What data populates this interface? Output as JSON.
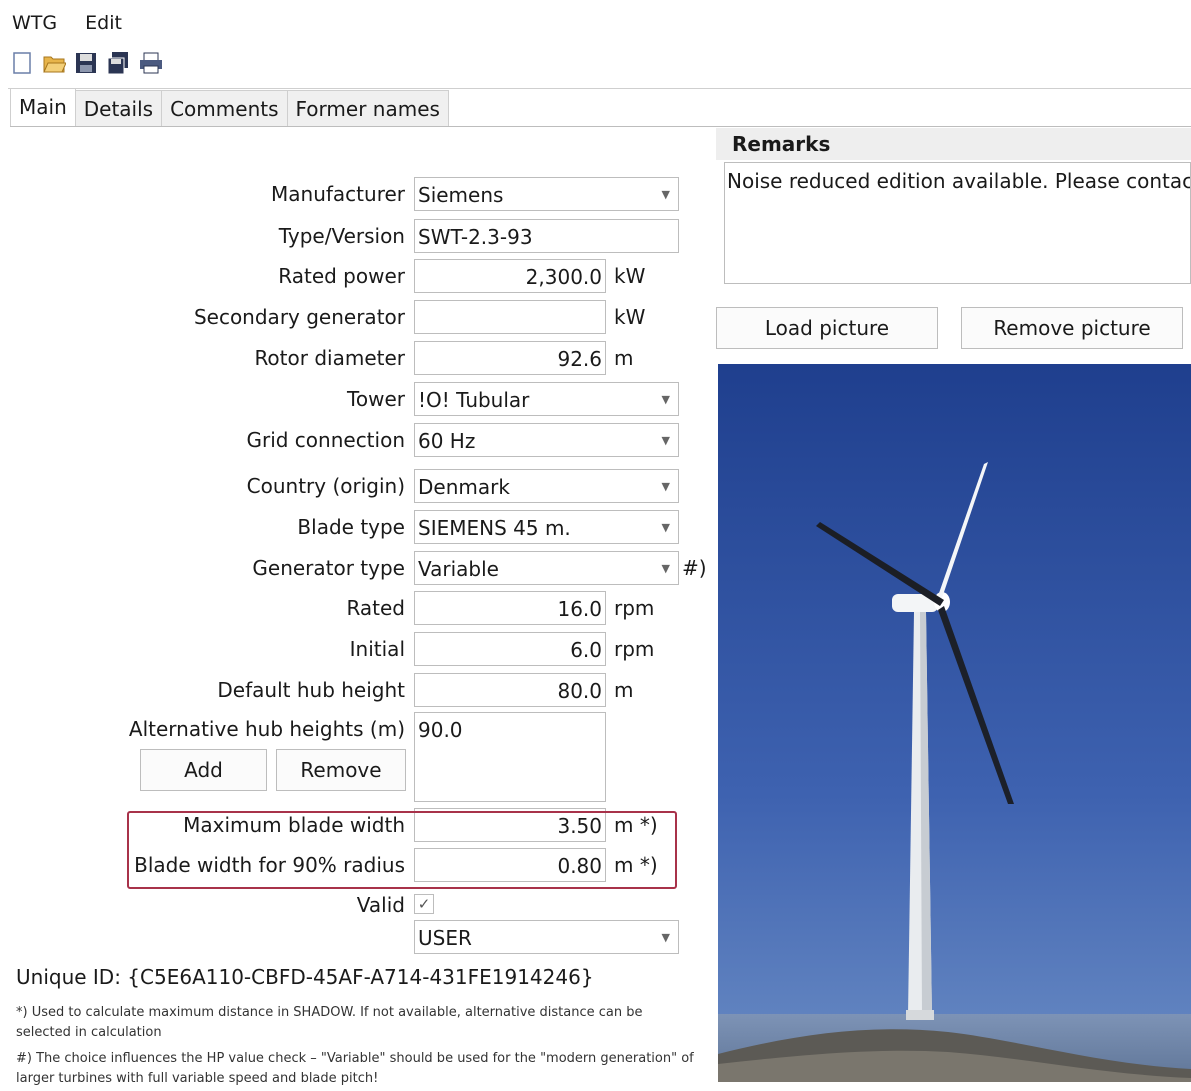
{
  "menu": {
    "items": [
      "WTG",
      "Edit"
    ]
  },
  "toolbar": {
    "icons": [
      "new-icon",
      "open-folder-icon",
      "save-icon",
      "save-as-icon",
      "print-icon"
    ]
  },
  "tabs": [
    "Main",
    "Details",
    "Comments",
    "Former names"
  ],
  "form": {
    "manufacturer": {
      "label": "Manufacturer",
      "value": "Siemens"
    },
    "type_version": {
      "label": "Type/Version",
      "value": "SWT-2.3-93"
    },
    "rated_power": {
      "label": "Rated power",
      "value": "2,300.0",
      "unit": "kW"
    },
    "secondary_generator": {
      "label": "Secondary generator",
      "value": "",
      "unit": "kW"
    },
    "rotor_diameter": {
      "label": "Rotor diameter",
      "value": "92.6",
      "unit": "m"
    },
    "tower": {
      "label": "Tower",
      "value": "!O! Tubular"
    },
    "grid_connection": {
      "label": "Grid connection",
      "value": "60 Hz"
    },
    "country": {
      "label": "Country (origin)",
      "value": "Denmark"
    },
    "blade_type": {
      "label": "Blade type",
      "value": "SIEMENS 45 m."
    },
    "generator_type": {
      "label": "Generator type",
      "value": "Variable",
      "suffix": "#)"
    },
    "rated": {
      "label": "Rated",
      "value": "16.0",
      "unit": "rpm"
    },
    "initial": {
      "label": "Initial",
      "value": "6.0",
      "unit": "rpm"
    },
    "default_hub_height": {
      "label": "Default hub height",
      "value": "80.0",
      "unit": "m"
    },
    "alt_hub_heights": {
      "label": "Alternative hub heights (m)",
      "value": "90.0"
    },
    "add_label": "Add",
    "remove_label": "Remove",
    "max_blade_width": {
      "label": "Maximum blade width",
      "value": "3.50",
      "unit": "m *)"
    },
    "blade_width_90": {
      "label": "Blade width for 90% radius",
      "value": "0.80",
      "unit": "m *)"
    },
    "valid": {
      "label": "Valid",
      "checked": true
    },
    "user_combo": {
      "value": "USER"
    }
  },
  "unique_id": "Unique ID: {C5E6A110-CBFD-45AF-A714-431FE1914246}",
  "notes": {
    "star": "*) Used to calculate maximum distance in SHADOW. If not available, alternative distance can be selected in calculation",
    "hash": "#) The choice influences the HP value check – \"Variable\" should be used for the \"modern generation\" of larger turbines with full variable speed and blade pitch!"
  },
  "remarks": {
    "title": "Remarks",
    "text": "Noise reduced edition available. Please contact"
  },
  "picture_buttons": {
    "load": "Load picture",
    "remove": "Remove picture"
  },
  "picture": {
    "subject": "wind-turbine-photo",
    "sky_color": "#2a4fa3",
    "sea_color": "#6e86a8"
  }
}
